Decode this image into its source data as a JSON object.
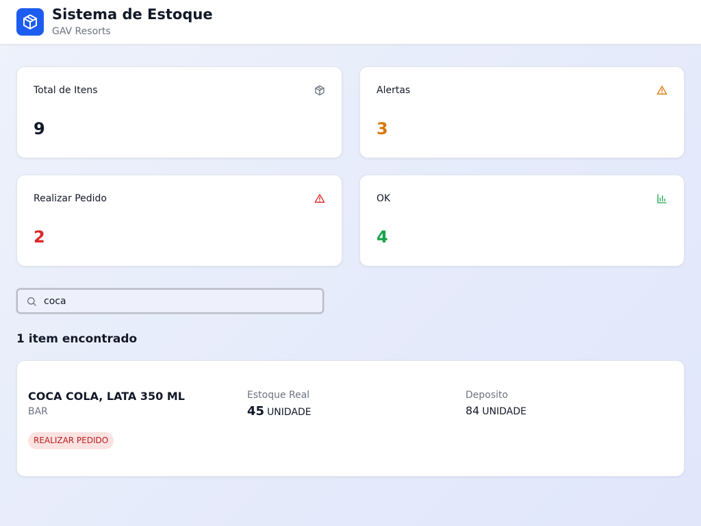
{
  "header": {
    "title": "Sistema de Estoque",
    "subtitle": "GAV Resorts",
    "logo_icon": "package-icon"
  },
  "stats": [
    {
      "label": "Total de Itens",
      "value": "9",
      "icon": "package-icon",
      "color": "#111827",
      "icon_color": "#6b7280"
    },
    {
      "label": "Alertas",
      "value": "3",
      "icon": "warning-triangle-icon",
      "color": "#d97706",
      "icon_color": "#d97706"
    },
    {
      "label": "Realizar Pedido",
      "value": "2",
      "icon": "alert-triangle-icon",
      "color": "#dc2626",
      "icon_color": "#dc2626"
    },
    {
      "label": "OK",
      "value": "4",
      "icon": "bar-chart-icon",
      "color": "#16a34a",
      "icon_color": "#16a34a"
    }
  ],
  "search": {
    "value": "coca",
    "icon": "search-icon"
  },
  "results": {
    "count_text": "1 item encontrado",
    "items": [
      {
        "name": "COCA COLA, LATA 350 ML",
        "category": "BAR",
        "status": "REALIZAR PEDIDO",
        "status_color": "#b91c1c",
        "estoque_label": "Estoque Real",
        "estoque_value": "45",
        "estoque_unit": "UNIDADE",
        "deposito_label": "Deposito",
        "deposito_value": "84",
        "deposito_unit": "UNIDADE"
      }
    ]
  },
  "colors": {
    "brand": "#1d5cf0",
    "warning": "#d97706",
    "danger": "#dc2626",
    "success": "#16a34a"
  }
}
